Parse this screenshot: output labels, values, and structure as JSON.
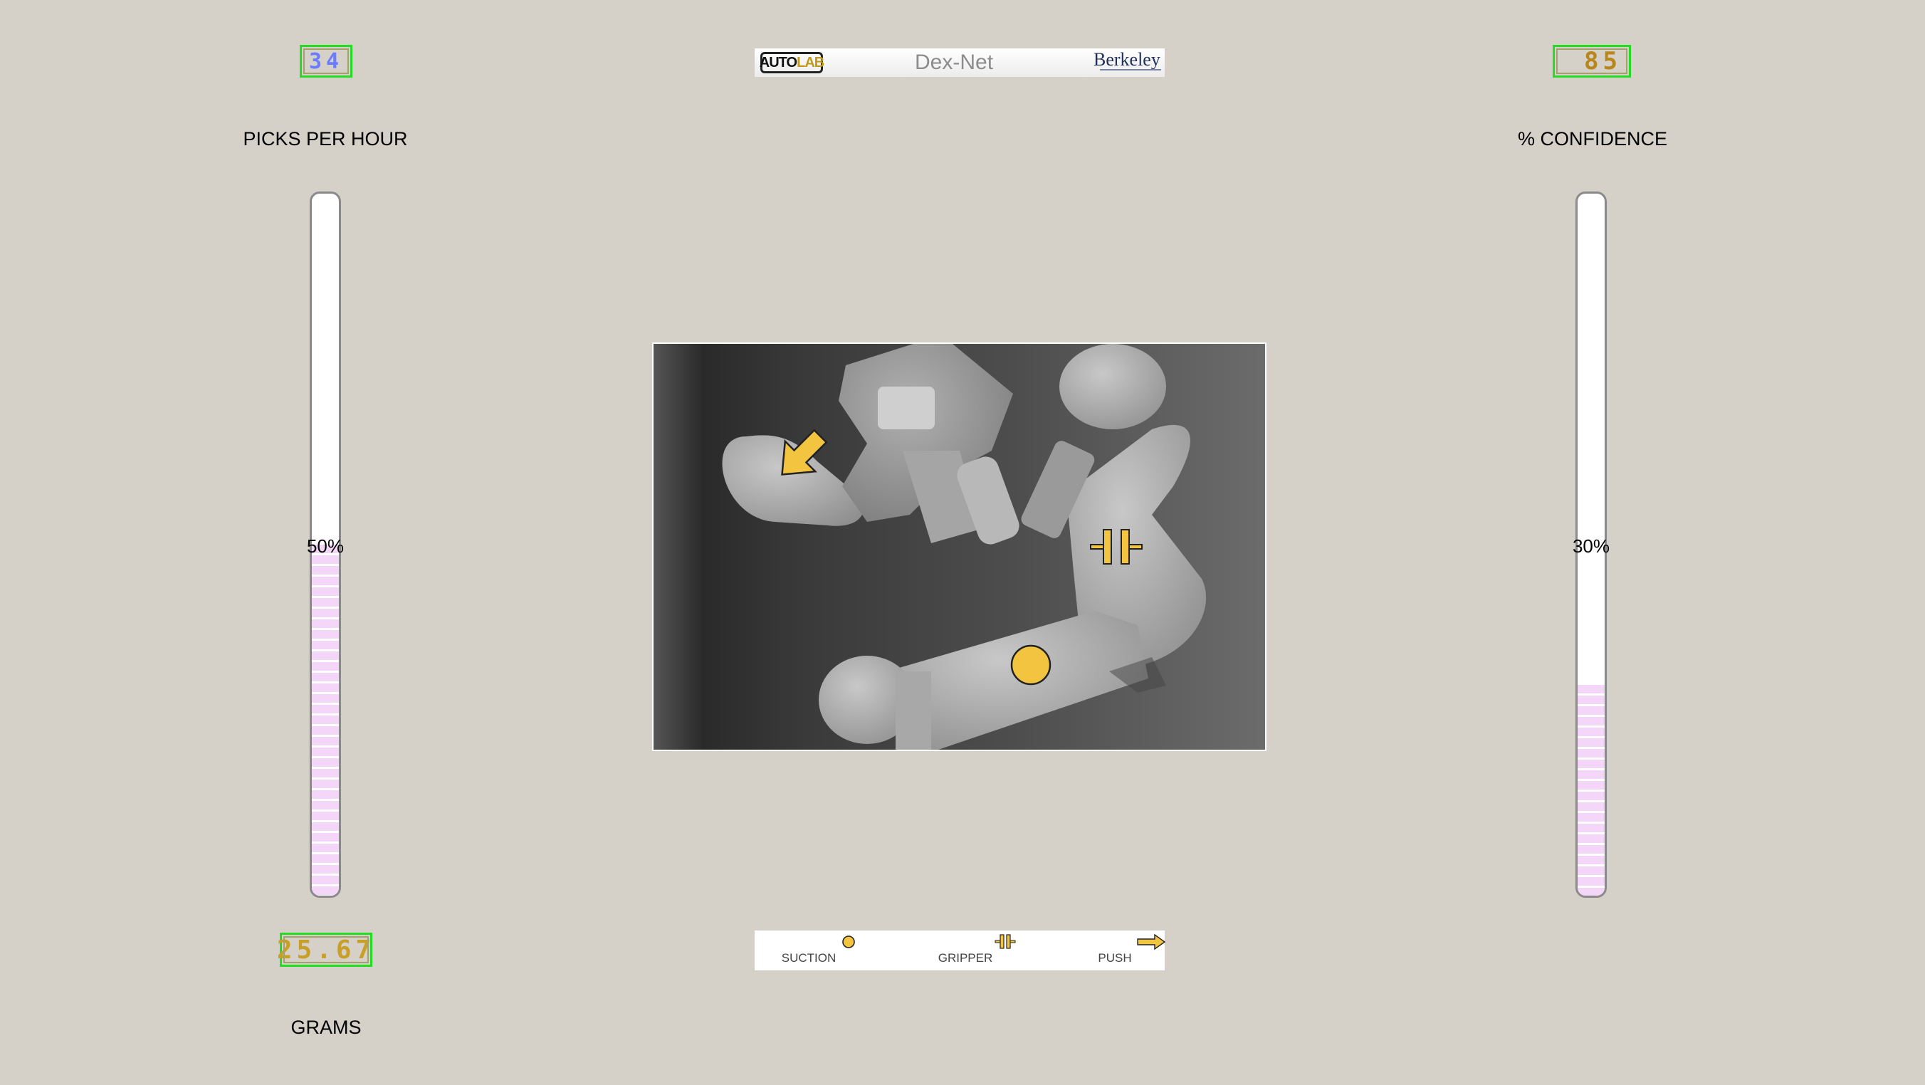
{
  "banner": {
    "autolab_a": "AUTO",
    "autolab_b": "LAB",
    "title": "Dex-Net",
    "university": "Berkeley"
  },
  "left_panel": {
    "top_readout": "34",
    "top_label": "PICKS PER HOUR",
    "gauge_pct_label": "50%",
    "gauge_level": 0.5,
    "bottom_readout": "25.67",
    "bottom_label": "GRAMS"
  },
  "right_panel": {
    "top_readout": "85",
    "top_label": "% CONFIDENCE",
    "gauge_pct_label": "30%",
    "gauge_level": 0.3
  },
  "legend": {
    "suction": "SUCTION",
    "gripper": "GRIPPER",
    "push": "PUSH"
  },
  "colors": {
    "background": "#d5d0c8",
    "readout_border": "#22dd22",
    "gauge_fill": "#f3d6f8",
    "marker": "#f2c440"
  },
  "icons": {
    "push": "arrow-icon",
    "gripper": "gripper-icon",
    "suction": "suction-circle-icon"
  }
}
